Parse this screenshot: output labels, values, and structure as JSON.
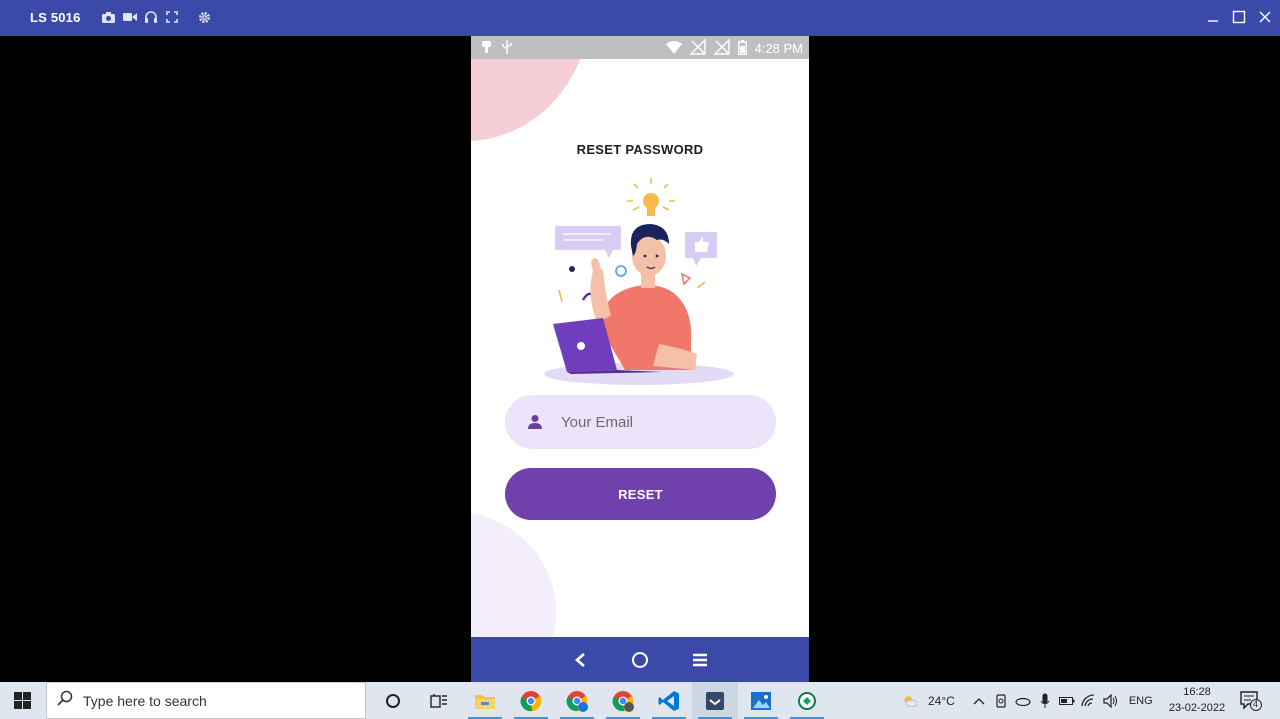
{
  "window": {
    "device_name": "LS 5016",
    "toolbar_icons": [
      "camera-icon",
      "video-icon",
      "headphones-icon",
      "fullscreen-icon",
      "settings-gear-icon"
    ],
    "controls": [
      "minimize-icon",
      "maximize-icon",
      "close-icon"
    ]
  },
  "phone": {
    "status_bar": {
      "time": "4:28 PM",
      "left_icons": [
        "notification-icon",
        "usb-icon"
      ],
      "right_icons": [
        "wifi-icon",
        "no-sim-icon",
        "no-sim-icon",
        "battery-icon"
      ]
    },
    "screen": {
      "title": "RESET PASSWORD",
      "email_placeholder": "Your Email",
      "reset_label": "RESET",
      "accent_color": "#7040ad",
      "field_color": "#ede4fb"
    },
    "nav_bar": [
      "back-icon",
      "home-icon",
      "menu-icon"
    ]
  },
  "taskbar": {
    "search_placeholder": "Type here to search",
    "pinned": [
      "task-view-icon",
      "widgets-icon",
      "file-explorer-icon",
      "chrome-icon",
      "chrome-icon",
      "chrome-icon",
      "vscode-icon",
      "app-icon",
      "photos-icon",
      "app-icon"
    ],
    "weather_temp": "24°C",
    "language": "ENG",
    "time": "16:28",
    "date": "23-02-2022",
    "notification_count": "4"
  }
}
